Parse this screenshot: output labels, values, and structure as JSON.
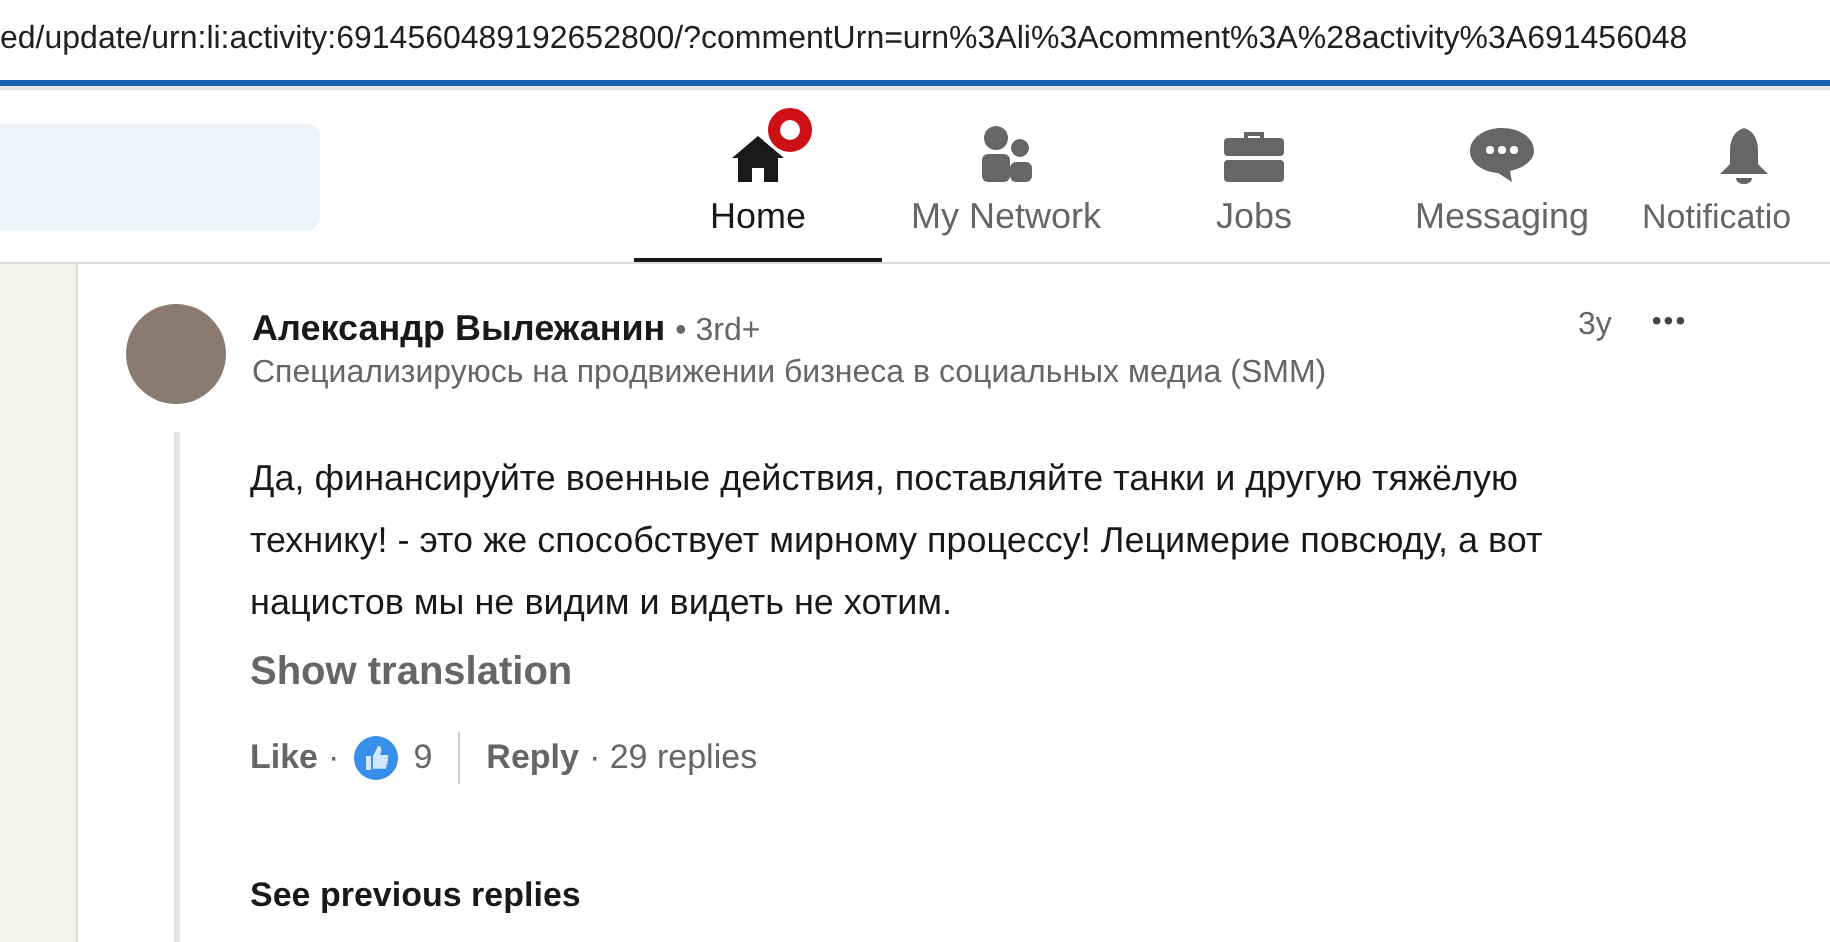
{
  "address_bar": {
    "url": "ed/update/urn:li:activity:6914560489192652800/?commentUrn=urn%3Ali%3Acomment%3A%28activity%3A691456048"
  },
  "nav": {
    "items": [
      {
        "label": "Home",
        "kind": "home",
        "selected": true,
        "badge": true
      },
      {
        "label": "My Network",
        "kind": "network",
        "selected": false,
        "badge": false
      },
      {
        "label": "Jobs",
        "kind": "jobs",
        "selected": false,
        "badge": false
      },
      {
        "label": "Messaging",
        "kind": "messaging",
        "selected": false,
        "badge": false
      },
      {
        "label": "Notificatio",
        "kind": "notifications",
        "selected": false,
        "badge": false
      }
    ]
  },
  "comment": {
    "author": "Александр Вылежанин",
    "degree": "• 3rd+",
    "headline": "Специализируюсь на продвижении бизнеса в социальных медиа (SMM)",
    "time": "3y",
    "more": "•••",
    "text": "Да, финансируйте военные действия, поставляйте танки и другую тяжёлую технику! - это же способствует мирному процессу! Лецимерие повсюду, а вот нацистов мы не видим и видеть не хотим.",
    "show_translation": "Show translation",
    "like": "Like",
    "like_sep": "·",
    "reaction_count": "9",
    "reply": "Reply",
    "replies_count": "· 29 replies"
  },
  "see_previous": "See previous replies"
}
